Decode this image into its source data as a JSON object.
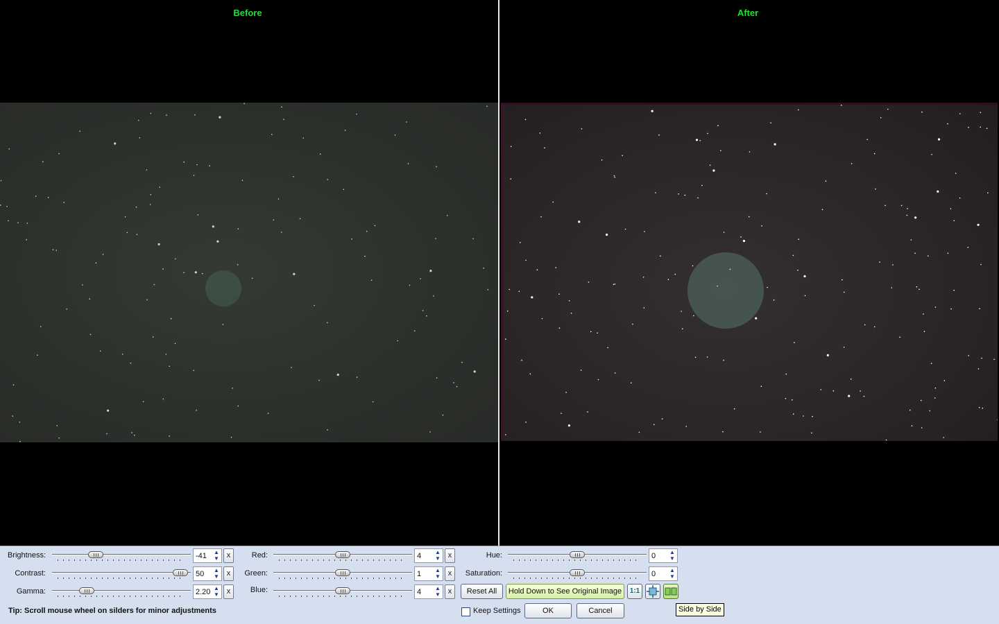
{
  "viewer": {
    "before_title": "Before",
    "after_title": "After"
  },
  "controls": {
    "brightness": {
      "label": "Brightness:",
      "value": "-41",
      "reset": "x",
      "level": 0.3
    },
    "contrast": {
      "label": "Contrast:",
      "value": "50",
      "reset": "x",
      "level": 0.96
    },
    "gamma": {
      "label": "Gamma:",
      "value": "2.20",
      "reset": "x",
      "level": 0.23
    },
    "red": {
      "label": "Red:",
      "value": "4",
      "reset": "x",
      "level": 0.5
    },
    "green": {
      "label": "Green:",
      "value": "1",
      "reset": "x",
      "level": 0.5
    },
    "blue": {
      "label": "Blue:",
      "value": "4",
      "reset": "x",
      "level": 0.5
    },
    "hue": {
      "label": "Hue:",
      "value": "0",
      "level": 0.5
    },
    "saturation": {
      "label": "Saturation:",
      "value": "0",
      "level": 0.5
    }
  },
  "buttons": {
    "reset_all": "Reset All",
    "hold_down": "Hold Down to See Original Image",
    "one_to_one": "1:1",
    "ok": "OK",
    "cancel": "Cancel"
  },
  "icons": {
    "fit": "fit-to-window-icon",
    "side_by_side": "side-by-side-icon"
  },
  "keep_settings": {
    "label": "Keep Settings",
    "checked": false
  },
  "tip": "Tip: Scroll mouse wheel on silders for minor adjustments",
  "tooltip": "Side by Side",
  "colors": {
    "title_green": "#22dd33",
    "panel_bg": "#d6dff0"
  }
}
